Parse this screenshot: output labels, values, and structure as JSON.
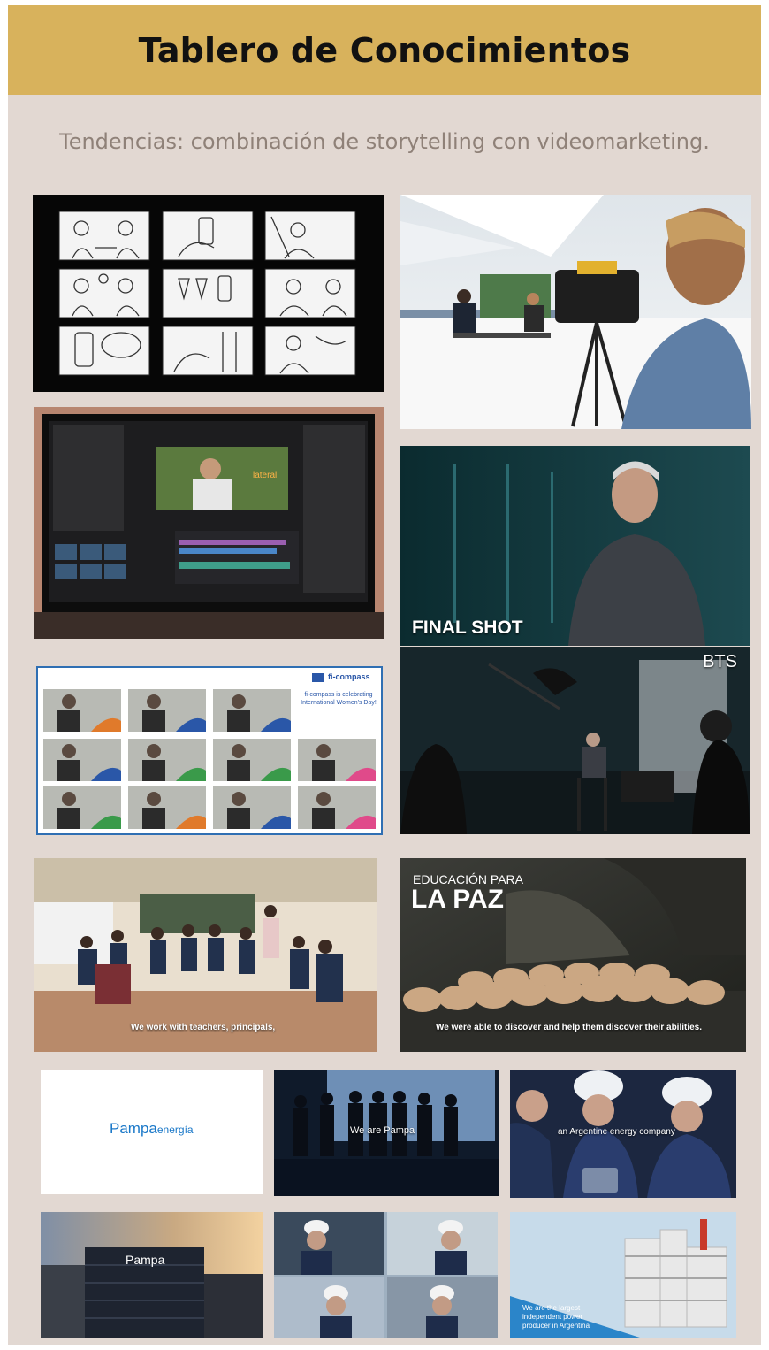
{
  "title": "Tablero de Conocimientos",
  "subtitle": "Tendencias: combinación de storytelling con videomarketing.",
  "tiles": {
    "final_shot": "FINAL SHOT",
    "bts": "BTS",
    "ficompass_logo": "fi-compass",
    "ficompass_msg": "fi-compass is celebrating International Women's Day!",
    "classroom_caption": "We work with teachers, principals,",
    "paz_line1": "EDUCACIÓN PARA",
    "paz_line2": "LA PAZ",
    "paz_caption": "We were able to discover and help them discover their abilities.",
    "pampa_logo_a": "Pampa",
    "pampa_logo_b": "energía",
    "we_are_pampa": "We are Pampa",
    "argentine": "an Argentine energy company",
    "pampa_building": "Pampa",
    "largest_1": "We are the largest",
    "largest_2": "independent power",
    "largest_3": "producer in Argentina"
  }
}
